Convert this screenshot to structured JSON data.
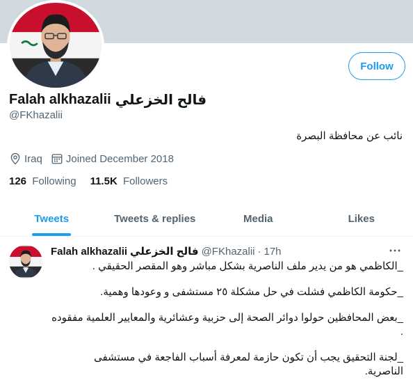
{
  "profile": {
    "display_name": "Falah alkhazalii",
    "display_name_ar": "فالح الخزعلي",
    "handle": "@FKhazalii",
    "bio": "نائب عن محافظة البصرة",
    "location": "Iraq",
    "joined": "Joined December 2018",
    "following_count": "126",
    "following_label": "Following",
    "followers_count": "11.5K",
    "followers_label": "Followers",
    "follow_label": "Follow",
    "location_icon": "map-pin-icon",
    "calendar_icon": "calendar-icon"
  },
  "tabs": [
    {
      "label": "Tweets",
      "active": true
    },
    {
      "label": "Tweets & replies",
      "active": false
    },
    {
      "label": "Media",
      "active": false
    },
    {
      "label": "Likes",
      "active": false
    }
  ],
  "tweet": {
    "name": "Falah alkhazalii",
    "name_ar": "فالح الخزعلي",
    "handle": "@FKhazalii",
    "dot": "·",
    "time": "17h",
    "lines": [
      "_الكاظمي هو من يدير ملف الناصرية بشكل مباشر وهو المقصر الحقيقي .",
      "_حكومة الكاظمي فشلت في حل مشكلة ٢٥ مستشفى و وعودها وهمية.",
      "_بعض المحافظين حولوا دوائر الصحة إلى حزبية وعشائرية والمعايير العلمية مفقوده",
      ".",
      "_لجنة التحقيق يجب أن تكون حازمة لمعرفة أسباب الفاجعة في مستشفى",
      "الناصرية."
    ]
  },
  "colors": {
    "accent": "#1d9bf0",
    "banner": "#cfd9de",
    "secondary_text": "#536471"
  }
}
